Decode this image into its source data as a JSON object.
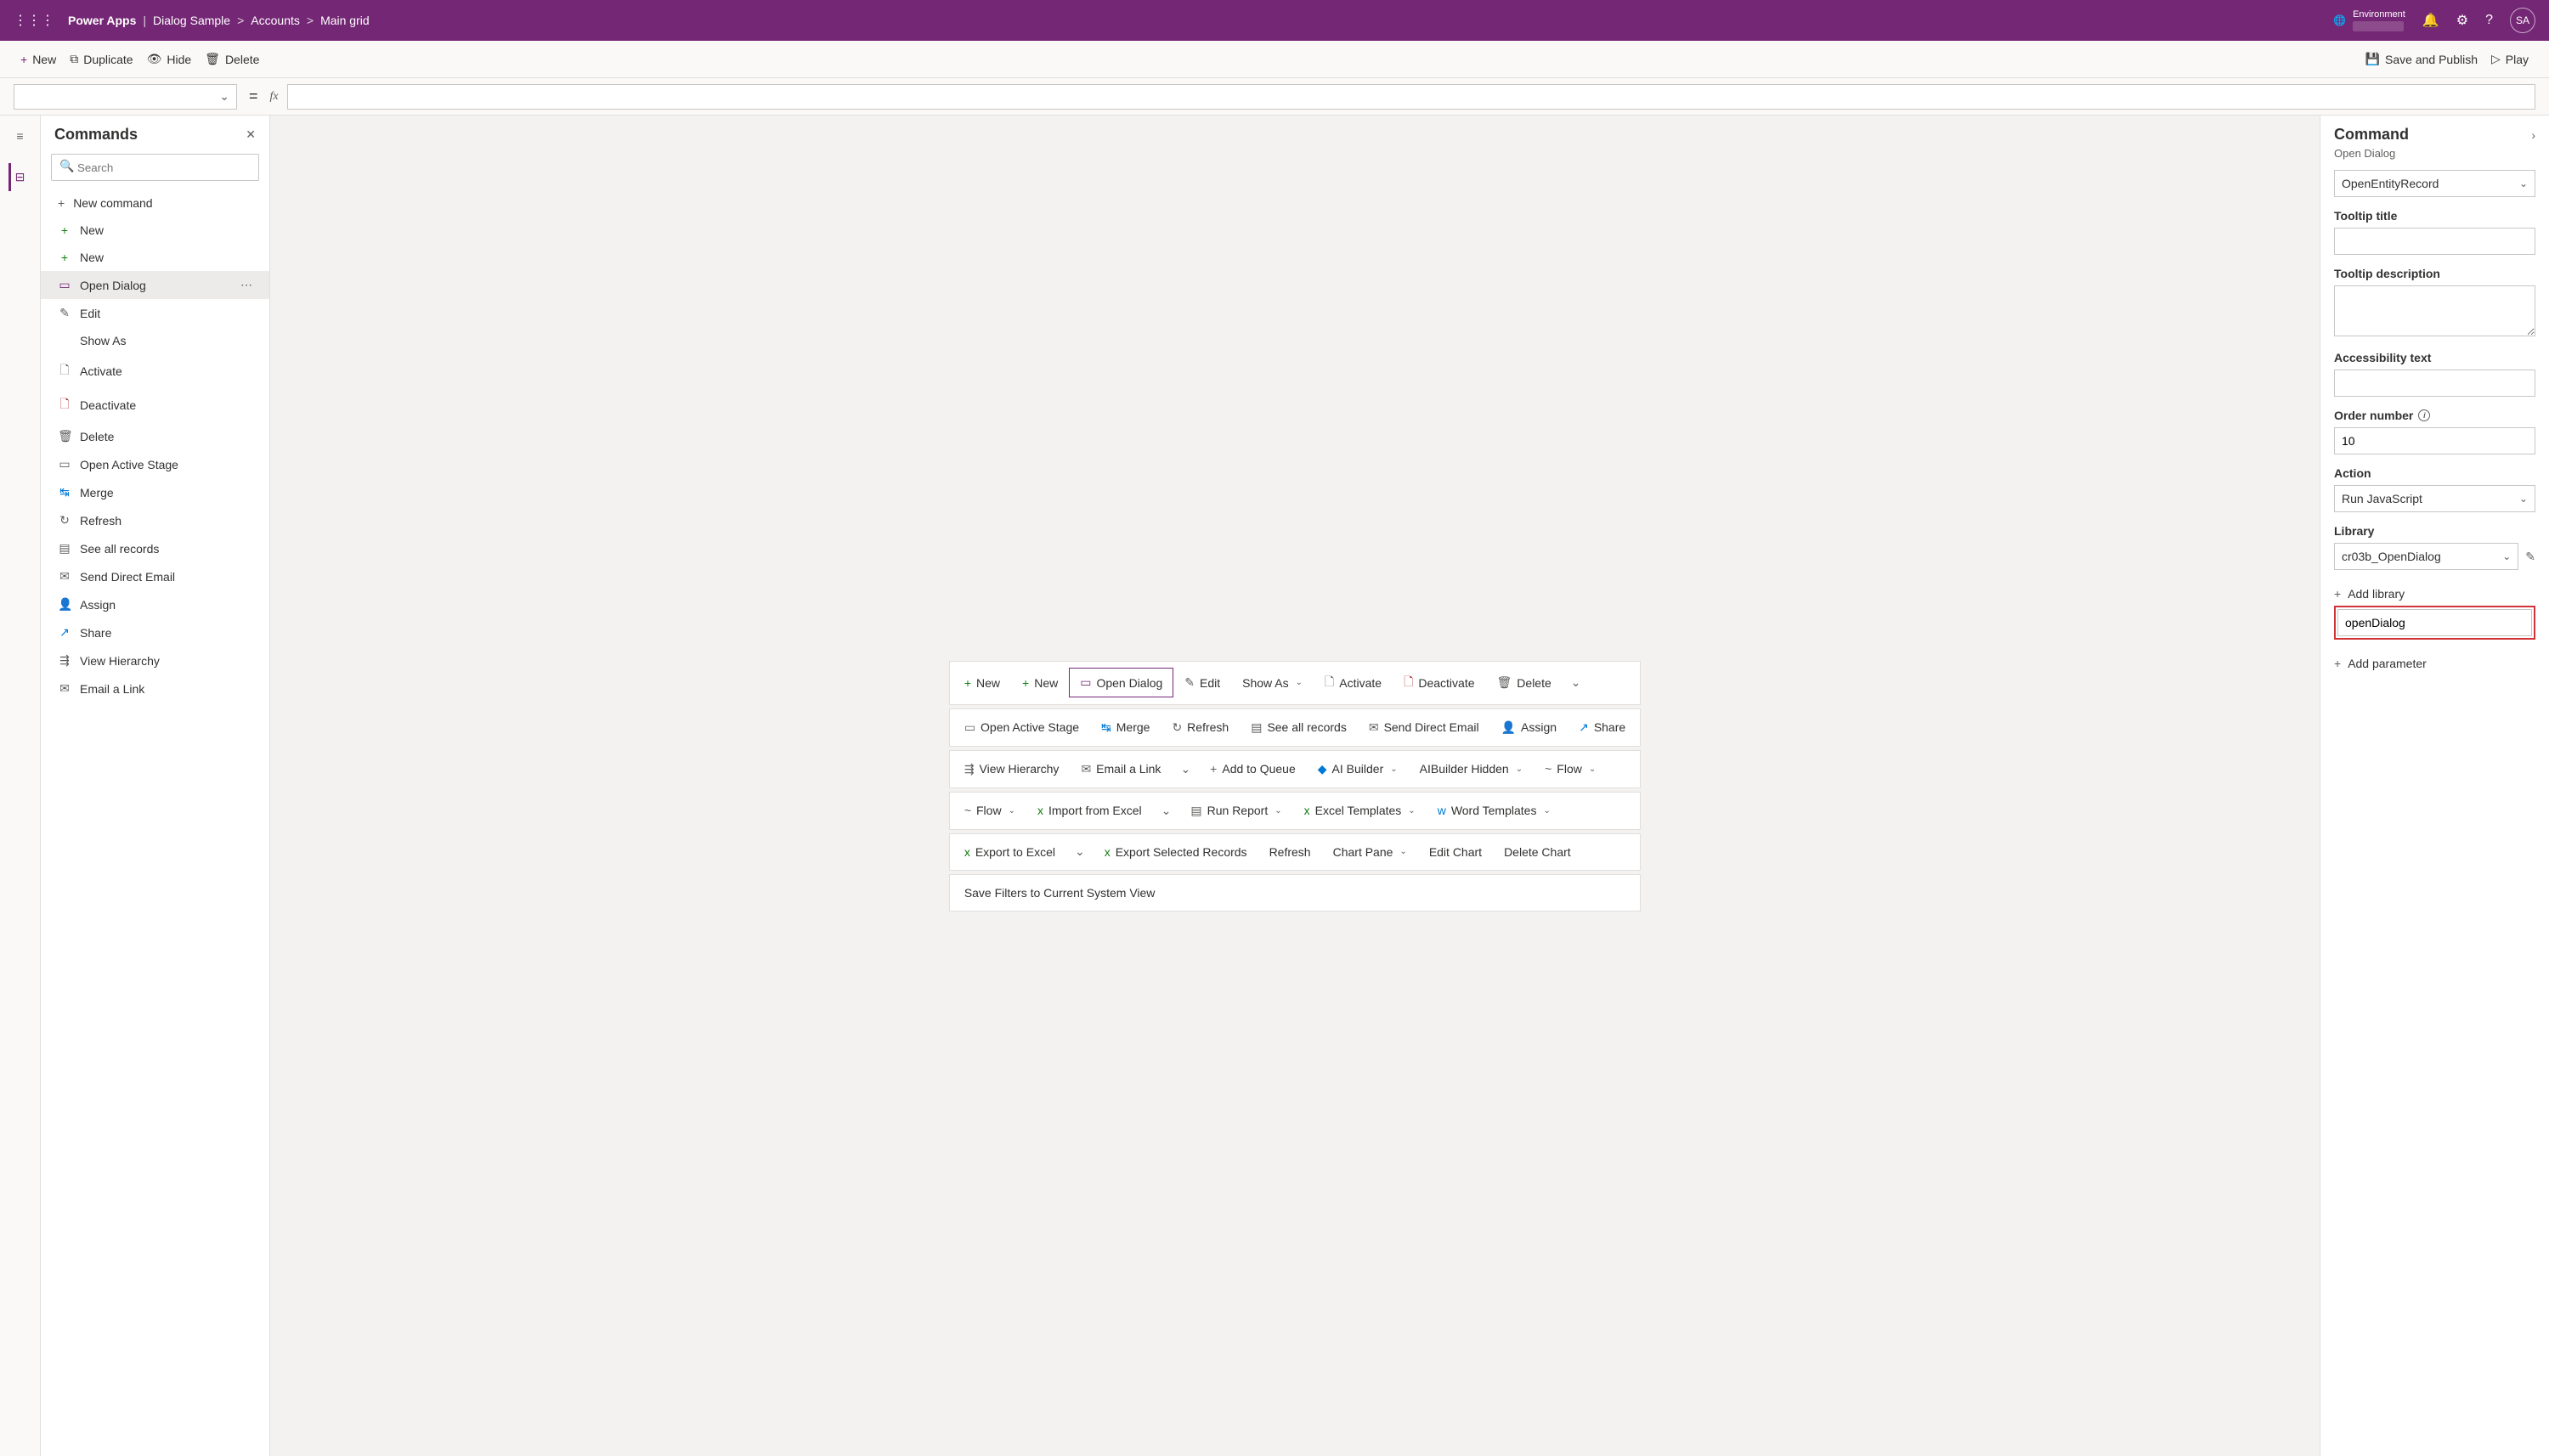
{
  "topbar": {
    "app": "Power Apps",
    "crumbs": [
      "Dialog Sample",
      "Accounts",
      "Main grid"
    ],
    "env_label": "Environment",
    "avatar_initials": "SA"
  },
  "toolbar": {
    "new": "New",
    "duplicate": "Duplicate",
    "hide": "Hide",
    "delete": "Delete",
    "save": "Save and Publish",
    "play": "Play"
  },
  "formula": {
    "fx": "fx"
  },
  "leftPanel": {
    "title": "Commands",
    "search_ph": "Search",
    "new_cmd": "New command",
    "items": [
      {
        "ic": "+",
        "cls": "green",
        "label": "New"
      },
      {
        "ic": "+",
        "cls": "green",
        "label": "New"
      },
      {
        "ic": "▭",
        "cls": "purple",
        "label": "Open Dialog",
        "selected": true
      },
      {
        "ic": "✎",
        "cls": "gray",
        "label": "Edit"
      },
      {
        "ic": "",
        "cls": "",
        "label": "Show As"
      },
      {
        "ic": "🗋",
        "cls": "gray",
        "label": "Activate"
      },
      {
        "ic": "🗋",
        "cls": "red",
        "label": "Deactivate"
      },
      {
        "ic": "🗑",
        "cls": "gray",
        "label": "Delete"
      },
      {
        "ic": "▭",
        "cls": "gray",
        "label": "Open Active Stage"
      },
      {
        "ic": "↹",
        "cls": "blue",
        "label": "Merge"
      },
      {
        "ic": "↻",
        "cls": "gray",
        "label": "Refresh"
      },
      {
        "ic": "▤",
        "cls": "gray",
        "label": "See all records"
      },
      {
        "ic": "✉",
        "cls": "gray",
        "label": "Send Direct Email"
      },
      {
        "ic": "👤",
        "cls": "gray",
        "label": "Assign"
      },
      {
        "ic": "↗",
        "cls": "blue",
        "label": "Share"
      },
      {
        "ic": "⇶",
        "cls": "gray",
        "label": "View Hierarchy"
      },
      {
        "ic": "✉",
        "cls": "gray",
        "label": "Email a Link"
      }
    ]
  },
  "canvas": {
    "rows": [
      [
        {
          "ic": "+",
          "cls": "green",
          "label": "New"
        },
        {
          "ic": "+",
          "cls": "green",
          "label": "New"
        },
        {
          "ic": "▭",
          "cls": "purple",
          "label": "Open Dialog",
          "selected": true
        },
        {
          "ic": "✎",
          "cls": "gray",
          "label": "Edit"
        },
        {
          "label": "Show As",
          "chev": true
        },
        {
          "ic": "🗋",
          "cls": "gray",
          "label": "Activate"
        },
        {
          "ic": "🗋",
          "cls": "red",
          "label": "Deactivate"
        },
        {
          "ic": "🗑",
          "cls": "gray",
          "label": "Delete"
        },
        {
          "overflow": true
        }
      ],
      [
        {
          "ic": "▭",
          "cls": "gray",
          "label": "Open Active Stage"
        },
        {
          "ic": "↹",
          "cls": "blue",
          "label": "Merge"
        },
        {
          "ic": "↻",
          "cls": "gray",
          "label": "Refresh"
        },
        {
          "ic": "▤",
          "cls": "gray",
          "label": "See all records"
        },
        {
          "ic": "✉",
          "cls": "gray",
          "label": "Send Direct Email"
        },
        {
          "ic": "👤",
          "cls": "gray",
          "label": "Assign"
        },
        {
          "ic": "↗",
          "cls": "blue",
          "label": "Share"
        }
      ],
      [
        {
          "ic": "⇶",
          "cls": "gray",
          "label": "View Hierarchy"
        },
        {
          "ic": "✉",
          "cls": "gray",
          "label": "Email a Link"
        },
        {
          "overflow": true
        },
        {
          "ic": "+",
          "cls": "gray",
          "label": "Add to Queue"
        },
        {
          "ic": "◆",
          "cls": "blue",
          "label": "AI Builder",
          "chev": true
        },
        {
          "label": "AIBuilder Hidden",
          "chev": true
        },
        {
          "ic": "~",
          "cls": "gray",
          "label": "Flow",
          "chev": true
        }
      ],
      [
        {
          "ic": "~",
          "cls": "gray",
          "label": "Flow",
          "chev": true
        },
        {
          "ic": "x",
          "cls": "green",
          "label": "Import from Excel"
        },
        {
          "overflow": true
        },
        {
          "ic": "▤",
          "cls": "gray",
          "label": "Run Report",
          "chev": true
        },
        {
          "ic": "x",
          "cls": "green",
          "label": "Excel Templates",
          "chev": true
        },
        {
          "ic": "w",
          "cls": "blue",
          "label": "Word Templates",
          "chev": true
        }
      ],
      [
        {
          "ic": "x",
          "cls": "green",
          "label": "Export to Excel"
        },
        {
          "overflow": true
        },
        {
          "ic": "x",
          "cls": "green",
          "label": "Export Selected Records"
        },
        {
          "label": "Refresh"
        },
        {
          "label": "Chart Pane",
          "chev": true
        },
        {
          "label": "Edit Chart"
        },
        {
          "label": "Delete Chart"
        }
      ],
      [
        {
          "label": "Save Filters to Current System View"
        }
      ]
    ]
  },
  "rightPanel": {
    "title": "Command",
    "subtitle": "Open Dialog",
    "top_select": "OpenEntityRecord",
    "tooltip_title_lbl": "Tooltip title",
    "tooltip_title_val": "",
    "tooltip_desc_lbl": "Tooltip description",
    "tooltip_desc_val": "",
    "acc_text_lbl": "Accessibility text",
    "acc_text_val": "",
    "order_lbl": "Order number",
    "order_val": "10",
    "action_lbl": "Action",
    "action_val": "Run JavaScript",
    "library_lbl": "Library",
    "library_val": "cr03b_OpenDialog",
    "add_library": "Add library",
    "fn_val": "openDialog",
    "add_param": "Add parameter"
  }
}
